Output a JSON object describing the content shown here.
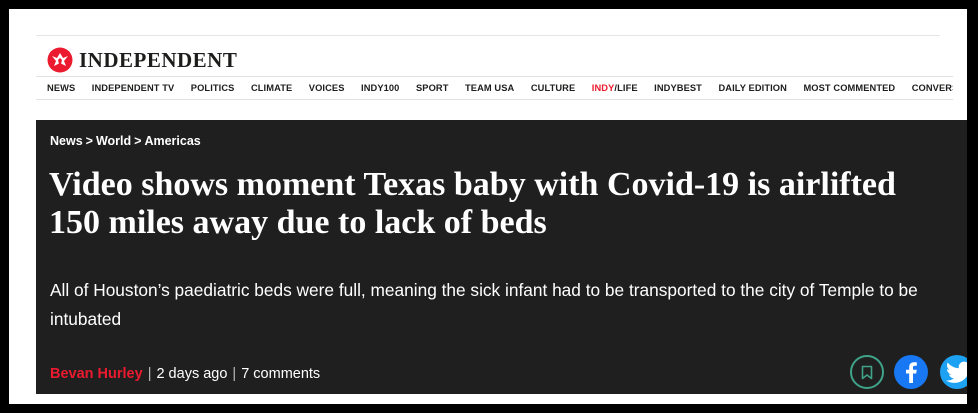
{
  "site": {
    "name": "INDEPENDENT"
  },
  "nav": {
    "items": [
      "NEWS",
      "INDEPENDENT TV",
      "POLITICS",
      "CLIMATE",
      "VOICES",
      "INDY100",
      "SPORT",
      "TEAM USA",
      "CULTURE"
    ],
    "indy_life": {
      "part1": "INDY",
      "sep": "/",
      "part2": "LIFE"
    },
    "items_after": [
      "INDYBEST",
      "DAILY EDITION",
      "MOST COMMENTED",
      "CONVERSATIONS"
    ]
  },
  "article": {
    "breadcrumb": [
      "News",
      "World",
      "Americas"
    ],
    "breadcrumb_sep": ">",
    "headline": "Video shows moment Texas baby with Covid-19 is airlifted 150 miles away due to lack of beds",
    "standfirst": "All of Houston’s paediatric beds were full, meaning the sick infant had to be transported to the city of Temple to be intubated",
    "author": "Bevan Hurley",
    "time": "2 days ago",
    "comments": "7 comments",
    "byline_sep": "|"
  },
  "share": {
    "bookmark_icon": "bookmark-icon",
    "facebook_icon": "facebook-icon",
    "twitter_icon": "twitter-icon"
  },
  "colors": {
    "brand_red": "#ec1a2e",
    "hero_bg": "#1f1f1f",
    "facebook": "#1877f2",
    "twitter": "#1da1f2",
    "bookmark_ring": "#3fa389"
  }
}
